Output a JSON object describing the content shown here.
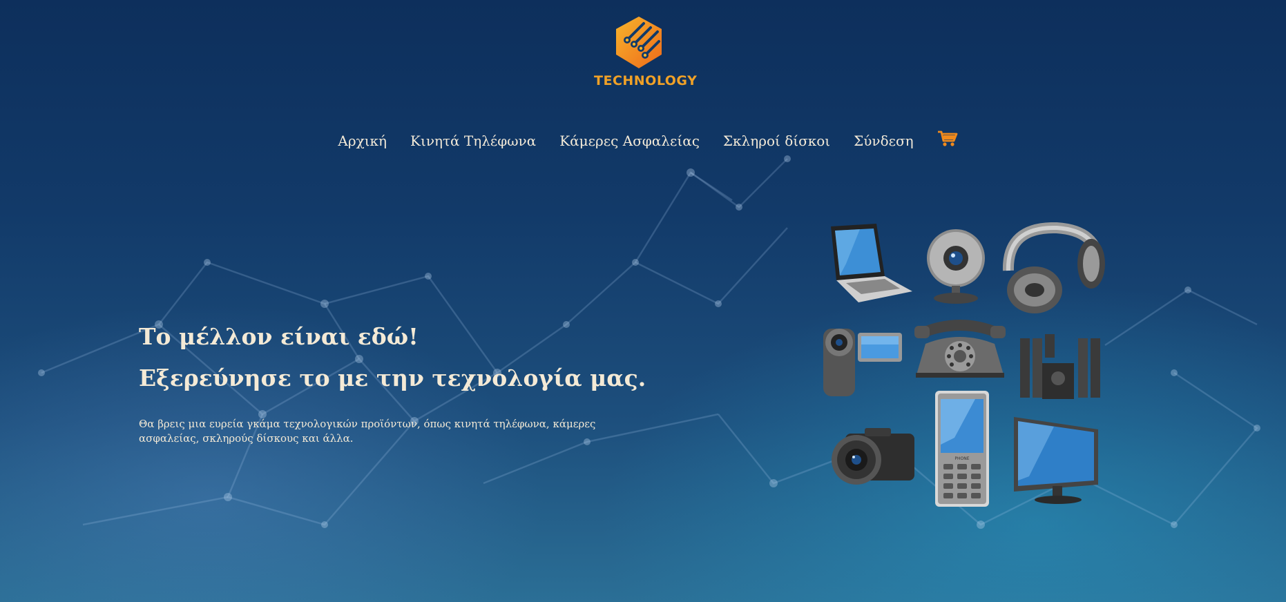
{
  "header": {
    "logo_text": "TECHNOLOGY",
    "logo_color": "#f0a127"
  },
  "nav": {
    "items": [
      {
        "label": "Αρχική"
      },
      {
        "label": "Κινητά Τηλέφωνα"
      },
      {
        "label": "Κάμερες Ασφαλείας"
      },
      {
        "label": "Σκληροί δίσκοι"
      },
      {
        "label": "Σύνδεση"
      }
    ],
    "cart_icon": "shopping-cart-icon",
    "cart_color": "#f08a1c"
  },
  "hero": {
    "headline_1": "Το μέλλον είναι εδώ!",
    "headline_2": "Εξερεύνησε το με την τεχνολογία μας.",
    "description": "Θα βρεις μια ευρεία γκάμα τεχνολογικών προϊόντων, όπως κινητά τηλέφωνα, κάμερες ασφαλείας, σκληρούς δίσκους και άλλα."
  },
  "products_illustration": {
    "icons": [
      "laptop-icon",
      "webcam-icon",
      "headphones-icon",
      "camcorder-icon",
      "telephone-icon",
      "speakers-icon",
      "camera-icon",
      "mobile-phone-icon",
      "monitor-icon"
    ],
    "phone_brand": "PHONE"
  }
}
